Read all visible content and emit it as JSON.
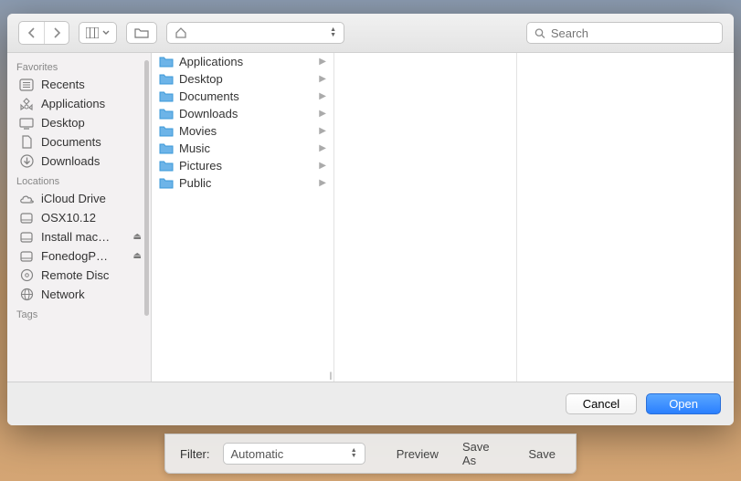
{
  "search": {
    "placeholder": "Search"
  },
  "path": {
    "selected": ""
  },
  "sidebar": {
    "sections": [
      {
        "title": "Favorites",
        "items": [
          {
            "label": "Recents",
            "icon": "square-list"
          },
          {
            "label": "Applications",
            "icon": "apps"
          },
          {
            "label": "Desktop",
            "icon": "desktop"
          },
          {
            "label": "Documents",
            "icon": "document"
          },
          {
            "label": "Downloads",
            "icon": "download"
          }
        ]
      },
      {
        "title": "Locations",
        "items": [
          {
            "label": "iCloud Drive",
            "icon": "cloud"
          },
          {
            "label": "OSX10.12",
            "icon": "disk"
          },
          {
            "label": "Install mac…",
            "icon": "disk",
            "ejectable": true
          },
          {
            "label": "FonedogP…",
            "icon": "disk",
            "ejectable": true
          },
          {
            "label": "Remote Disc",
            "icon": "optical"
          },
          {
            "label": "Network",
            "icon": "globe"
          }
        ]
      },
      {
        "title": "Tags",
        "items": []
      }
    ]
  },
  "column0": [
    {
      "name": "Applications"
    },
    {
      "name": "Desktop"
    },
    {
      "name": "Documents"
    },
    {
      "name": "Downloads"
    },
    {
      "name": "Movies"
    },
    {
      "name": "Music"
    },
    {
      "name": "Pictures"
    },
    {
      "name": "Public"
    }
  ],
  "footer": {
    "cancel": "Cancel",
    "open": "Open"
  },
  "bottomBar": {
    "filterLabel": "Filter:",
    "filterValue": "Automatic",
    "preview": "Preview",
    "saveAs": "Save As",
    "save": "Save"
  }
}
